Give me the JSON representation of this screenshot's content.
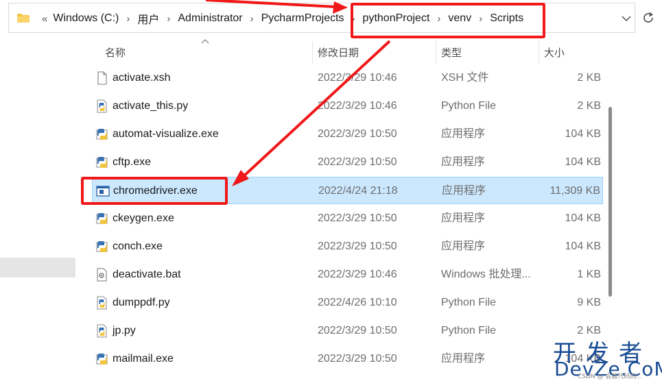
{
  "address_bar": {
    "overflow": "«",
    "crumbs": [
      "Windows (C:)",
      "用户",
      "Administrator",
      "PycharmProjects",
      "pythonProject",
      "venv",
      "Scripts"
    ]
  },
  "columns": {
    "name": "名称",
    "date": "修改日期",
    "type": "类型",
    "size": "大小"
  },
  "files": [
    {
      "icon": "text-file-icon",
      "name": "activate.xsh",
      "date": "2022/3/29 10:46",
      "type": "XSH 文件",
      "size": "2 KB"
    },
    {
      "icon": "python-file-icon",
      "name": "activate_this.py",
      "date": "2022/3/29 10:46",
      "type": "Python File",
      "size": "2 KB"
    },
    {
      "icon": "python-exe-icon",
      "name": "automat-visualize.exe",
      "date": "2022/3/29 10:50",
      "type": "应用程序",
      "size": "104 KB"
    },
    {
      "icon": "python-exe-icon",
      "name": "cftp.exe",
      "date": "2022/3/29 10:50",
      "type": "应用程序",
      "size": "104 KB"
    },
    {
      "icon": "app-window-icon",
      "name": "chromedriver.exe",
      "date": "2022/4/24 21:18",
      "type": "应用程序",
      "size": "11,309 KB"
    },
    {
      "icon": "python-exe-icon",
      "name": "ckeygen.exe",
      "date": "2022/3/29 10:50",
      "type": "应用程序",
      "size": "104 KB"
    },
    {
      "icon": "python-exe-icon",
      "name": "conch.exe",
      "date": "2022/3/29 10:50",
      "type": "应用程序",
      "size": "104 KB"
    },
    {
      "icon": "batch-file-icon",
      "name": "deactivate.bat",
      "date": "2022/3/29 10:46",
      "type": "Windows 批处理...",
      "size": "1 KB"
    },
    {
      "icon": "python-file-icon",
      "name": "dumppdf.py",
      "date": "2022/4/26 10:10",
      "type": "Python File",
      "size": "9 KB"
    },
    {
      "icon": "python-file-icon",
      "name": "jp.py",
      "date": "2022/3/29 10:50",
      "type": "Python File",
      "size": "2 KB"
    },
    {
      "icon": "python-exe-icon",
      "name": "mailmail.exe",
      "date": "2022/3/29 10:50",
      "type": "应用程序",
      "size": "104 KB"
    }
  ],
  "selected_file": "chromedriver.exe",
  "watermark": {
    "top": "开发者",
    "bottom": "DevZe.CoM",
    "small": "CSDN @ 会敲代码的..."
  },
  "colors": {
    "selection": "#cce8ff",
    "annotation": "#f01818"
  }
}
